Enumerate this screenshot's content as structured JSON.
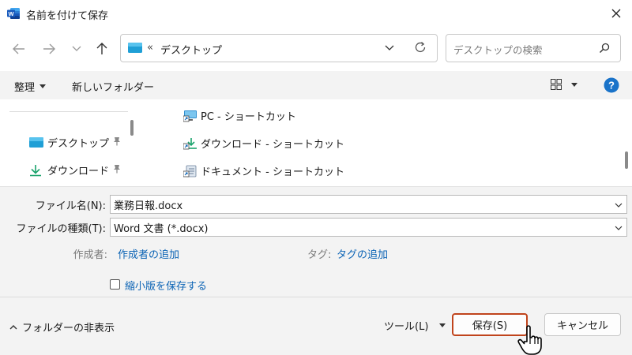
{
  "window": {
    "title": "名前を付けて保存",
    "icon": "word-app-icon"
  },
  "nav": {
    "path_prefix": "«",
    "location": "デスクトップ",
    "search_placeholder": "デスクトップの検索"
  },
  "toolbar": {
    "organize": "整理",
    "new_folder": "新しいフォルダー"
  },
  "sidebar": {
    "items": [
      {
        "label": "デスクトップ",
        "icon": "desktop-folder-icon"
      },
      {
        "label": "ダウンロード",
        "icon": "download-folder-icon"
      }
    ]
  },
  "files": [
    {
      "name": "PC - ショートカット",
      "icon": "pc-shortcut-icon"
    },
    {
      "name": "ダウンロード - ショートカット",
      "icon": "download-shortcut-icon"
    },
    {
      "name": "ドキュメント - ショートカット",
      "icon": "documents-shortcut-icon"
    }
  ],
  "form": {
    "filename_label": "ファイル名(N):",
    "filename_value": "業務日報.docx",
    "filetype_label": "ファイルの種類(T):",
    "filetype_value": "Word 文書 (*.docx)",
    "author_label": "作成者:",
    "author_link": "作成者の追加",
    "tags_label": "タグ:",
    "tags_link": "タグの追加",
    "thumbnail_label": "縮小版を保存する"
  },
  "footer": {
    "hide_folders": "フォルダーの非表示",
    "tools": "ツール(L)",
    "save": "保存(S)",
    "cancel": "キャンセル"
  },
  "colors": {
    "accent": "#0b63b5",
    "save_border": "#c0441c",
    "help": "#1a73c9"
  }
}
